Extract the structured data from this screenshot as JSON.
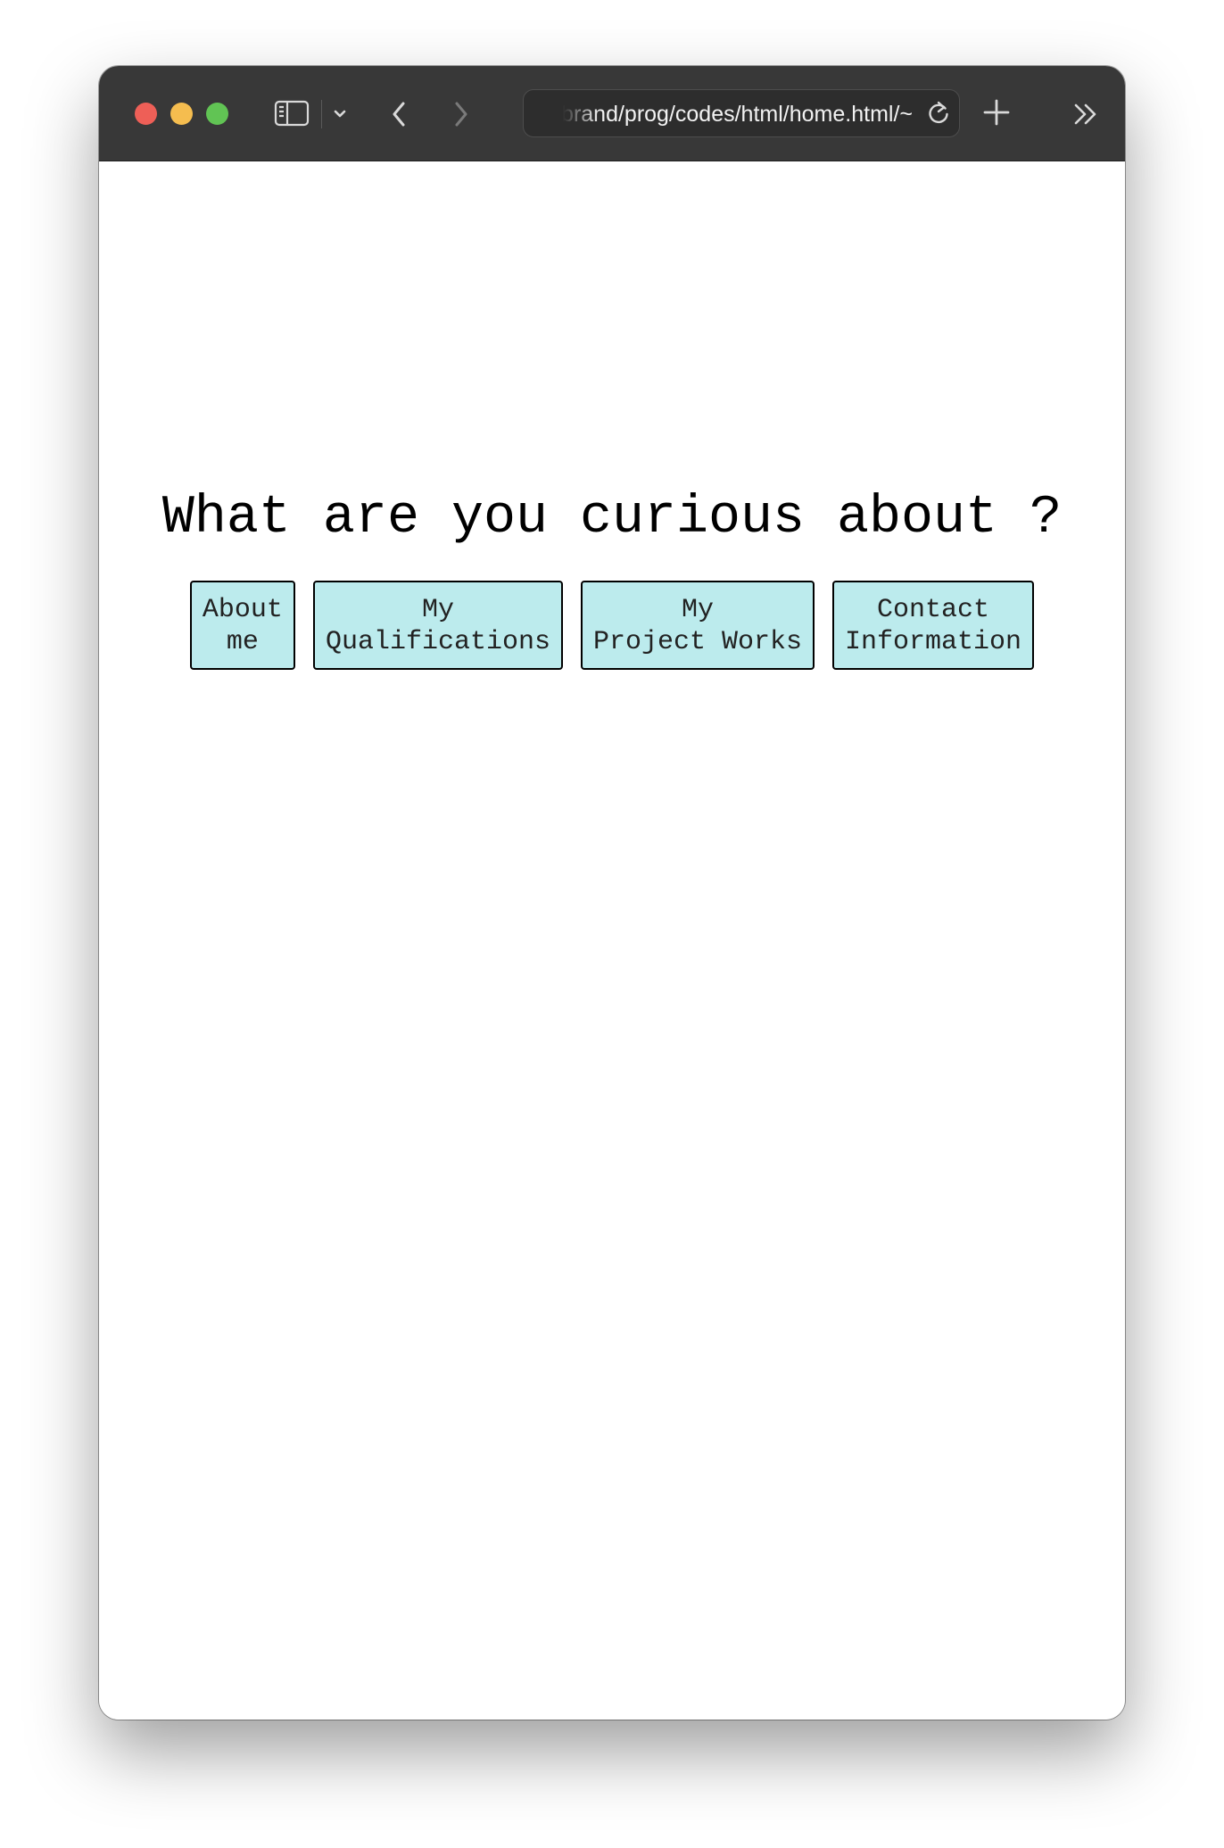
{
  "browser": {
    "address": "~/Desktop/personal-website-brand/prog/codes/html/home.html",
    "icons": {
      "sidebar": "sidebar-toggle-icon",
      "chevron": "chevron-down-icon",
      "back": "back-arrow-icon",
      "forward": "forward-arrow-icon",
      "reload": "reload-icon",
      "new_tab": "plus-icon",
      "overflow": "double-chevron-right-icon"
    },
    "colors": {
      "toolbar": "#383838",
      "close": "#ee5f57",
      "minimize": "#f5bd4f",
      "zoom": "#61c454"
    }
  },
  "page": {
    "heading": "What are you curious about ?",
    "buttons": [
      {
        "label": "About\nme"
      },
      {
        "label": "My\nQualifications"
      },
      {
        "label": "My\nProject Works"
      },
      {
        "label": "Contact\nInformation"
      }
    ],
    "colors": {
      "button_background": "#bcebed",
      "button_border": "#000000",
      "background": "#ffffff"
    }
  }
}
